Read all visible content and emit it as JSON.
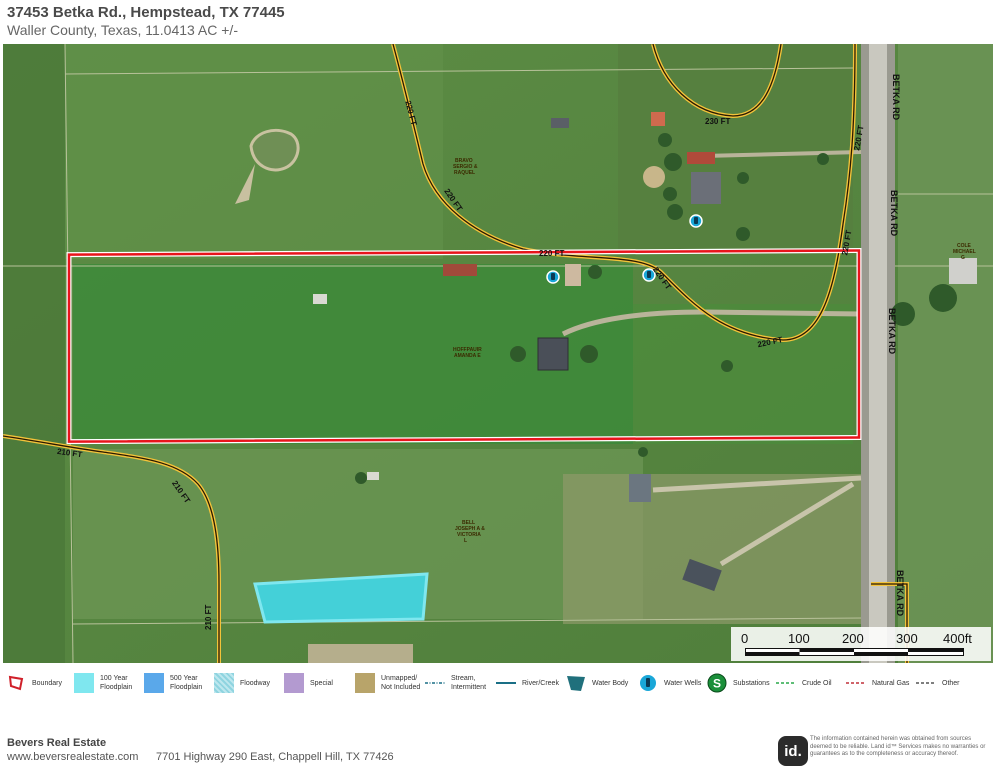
{
  "header": {
    "title": "37453 Betka Rd., Hempstead, TX  77445",
    "subtitle": "Waller County, Texas, 11.0413 AC +/-"
  },
  "map": {
    "road_label": "BETKA RD",
    "contour_labels": {
      "c210": "210 FT",
      "c220": "220 FT",
      "c230": "230 FT"
    },
    "owners": {
      "bravo": [
        "BRAVO",
        "SERGIO &",
        "RAQUEL"
      ],
      "hoffpauir": [
        "HOFFPAUIR",
        "AMANDA E"
      ],
      "bell": [
        "BELL",
        "JOSEPH A &",
        "VICTORIA",
        "L"
      ],
      "cole": [
        "COLE",
        "MICHAEL",
        "G"
      ]
    },
    "boundary_color": "#e8141b",
    "contour_color": "#2a1a00",
    "water_color": "#44d0d8"
  },
  "scale_bar": {
    "labels": [
      "0",
      "100",
      "200",
      "300",
      "400ft"
    ]
  },
  "legend": {
    "items": [
      {
        "key": "boundary",
        "label": "Boundary",
        "icon": "boundary-icon"
      },
      {
        "key": "floodplain100",
        "label": "100 Year Floodplain",
        "color": "#7fe7ef"
      },
      {
        "key": "floodplain500",
        "label": "500 Year Floodplain",
        "color": "#5aa8ea"
      },
      {
        "key": "floodway",
        "label": "Floodway",
        "color": "#bde7ee"
      },
      {
        "key": "special",
        "label": "Special",
        "color": "#b39ad0"
      },
      {
        "key": "unmapped",
        "label": "Unmapped/ Not Included",
        "color": "#b8a46a"
      },
      {
        "key": "stream",
        "label": "Stream, Intermittent",
        "icon": "stream-icon"
      },
      {
        "key": "river",
        "label": "River/Creek",
        "icon": "river-icon"
      },
      {
        "key": "waterbody",
        "label": "Water Body",
        "color": "#20707c"
      },
      {
        "key": "wells",
        "label": "Water Wells",
        "icon": "water-well-icon"
      },
      {
        "key": "substations",
        "label": "Substations",
        "icon": "substation-icon"
      },
      {
        "key": "crude",
        "label": "Crude Oil",
        "icon": "crude-oil-line-icon"
      },
      {
        "key": "gas",
        "label": "Natural Gas",
        "icon": "natural-gas-line-icon"
      },
      {
        "key": "other",
        "label": "Other",
        "icon": "other-line-icon"
      }
    ]
  },
  "footer": {
    "company": "Bevers Real Estate",
    "website": "www.beversrealestate.com",
    "address": "7701 Highway 290 East, Chappell Hill, TX  77426",
    "logo_text": "id.",
    "disclaimer": "The information contained herein was obtained from sources deemed to be reliable. Land id™ Services makes no warranties or guarantees as to the completeness or accuracy thereof."
  }
}
